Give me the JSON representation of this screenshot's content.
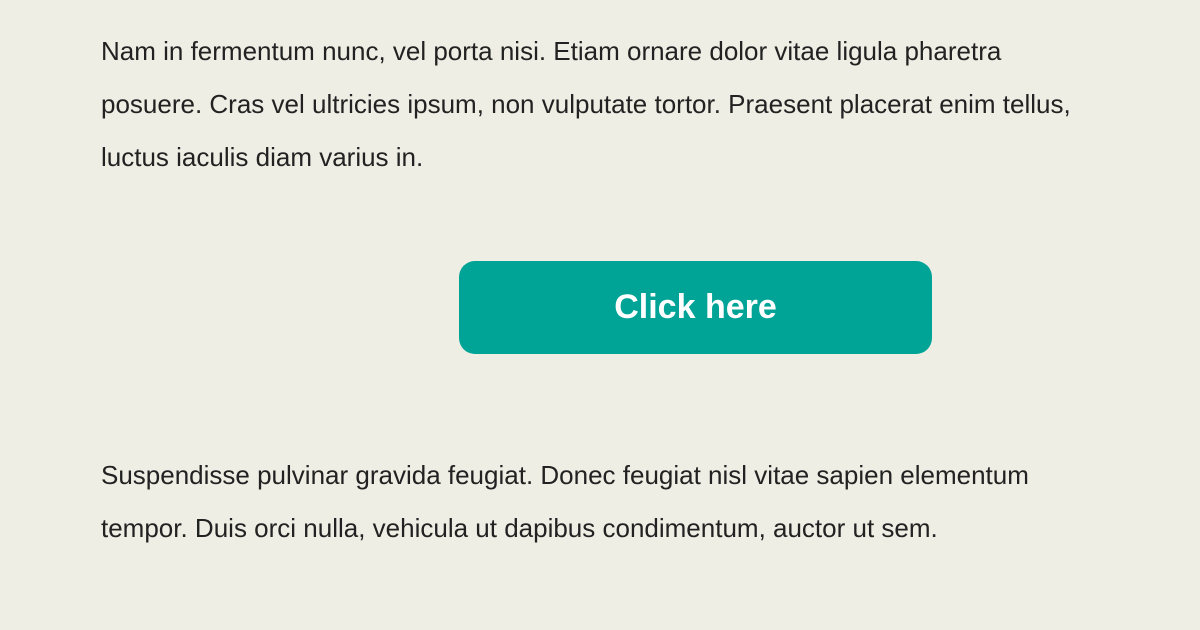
{
  "content": {
    "paragraph_top": "Nam in fermentum nunc, vel porta nisi. Etiam ornare dolor vitae ligula pharetra posuere. Cras vel ultricies ipsum, non vulputate tortor. Praesent placerat enim tellus, luctus iaculis diam varius in.",
    "cta_label": "Click here",
    "paragraph_bottom": "Suspendisse pulvinar gravida feugiat. Donec feugiat nisl vitae sapien elementum tempor. Duis orci nulla, vehicula ut dapibus condimentum, auctor ut sem."
  },
  "colors": {
    "background": "#eeeee4",
    "text": "#222222",
    "button": "#00a497",
    "button_text": "#ffffff"
  }
}
